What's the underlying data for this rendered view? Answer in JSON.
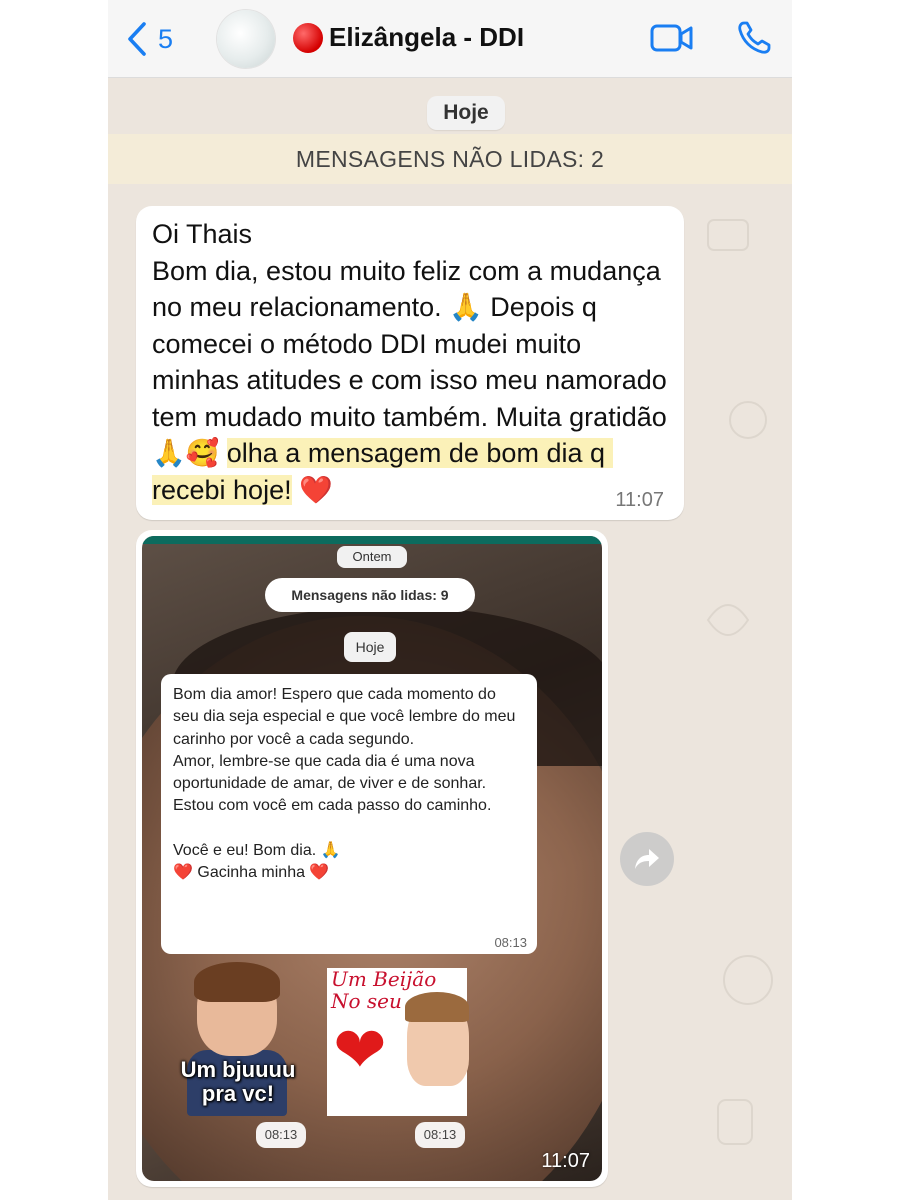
{
  "header": {
    "back_count": "5",
    "contact_name": "Elizângela - DDI",
    "status_dot_color": "#d40000",
    "accent_color": "#1a7ef2",
    "icons": [
      "back-chevron-icon",
      "video-call-icon",
      "phone-call-icon"
    ]
  },
  "chat": {
    "day_label": "Hoje",
    "unread_banner": "MENSAGENS NÃO LIDAS: 2",
    "message": {
      "line1": "Oi Thais",
      "body": "Bom dia, estou muito feliz com a mudança no meu relacionamento. 🙏 Depois q comecei o método DDI mudei muito minhas atitudes e com isso meu namorado tem mudado muito também. Muita gratidão 🙏🥰 ",
      "highlighted": "olha a mensagem de bom dia q recebi hoje!",
      "tail": " ❤️",
      "time": "11:07"
    },
    "image_message": {
      "time": "11:07",
      "screenshot": {
        "prev_day_label": "Ontem",
        "unread_label": "Mensagens não lidas: 9",
        "day_label": "Hoje",
        "inner_message": {
          "text": "Bom dia amor! Espero que cada momento do seu dia seja especial e que você lembre do meu carinho por você a cada segundo.\nAmor, lembre-se que cada dia é uma nova oportunidade de amar, de viver e de sonhar. Estou com você em cada passo do caminho.\n\nVocê e eu! Bom dia. 🙏\n❤️ Gacinha minha ❤️",
          "time": "08:13"
        },
        "sticker_1": {
          "caption": "Um bjuuuu pra vc!",
          "time": "08:13"
        },
        "sticker_2": {
          "caption": "Um Beijão No seu",
          "time": "08:13"
        }
      }
    },
    "forward_icon": "forward-arrow-icon"
  }
}
